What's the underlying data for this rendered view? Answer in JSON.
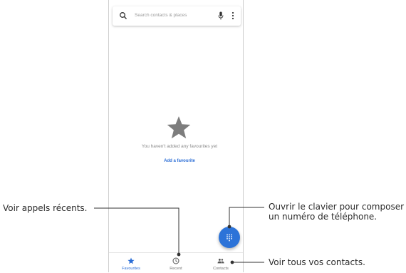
{
  "search": {
    "placeholder": "Search contacts & places",
    "icon": "search-icon",
    "mic_icon": "mic-icon",
    "more_icon": "more-vert-icon"
  },
  "empty_state": {
    "icon": "star-icon",
    "message": "You haven't added any favourites yet",
    "action": "Add a favourite"
  },
  "fab": {
    "icon": "dialpad-icon"
  },
  "nav": {
    "tabs": [
      {
        "label": "Favourites",
        "icon": "star-icon",
        "active": true
      },
      {
        "label": "Recent",
        "icon": "clock-icon",
        "active": false
      },
      {
        "label": "Contacts",
        "icon": "people-icon",
        "active": false
      }
    ]
  },
  "annotations": {
    "recent": "Voir appels récents.",
    "dialpad_line1": "Ouvrir le clavier pour composer",
    "dialpad_line2": "un numéro de téléphone.",
    "contacts": "Voir tous vos contacts."
  },
  "colors": {
    "accent": "#2a6dd6",
    "fab": "#2c73d8",
    "star": "#7d7d7d",
    "annotation_line": "#333333"
  }
}
